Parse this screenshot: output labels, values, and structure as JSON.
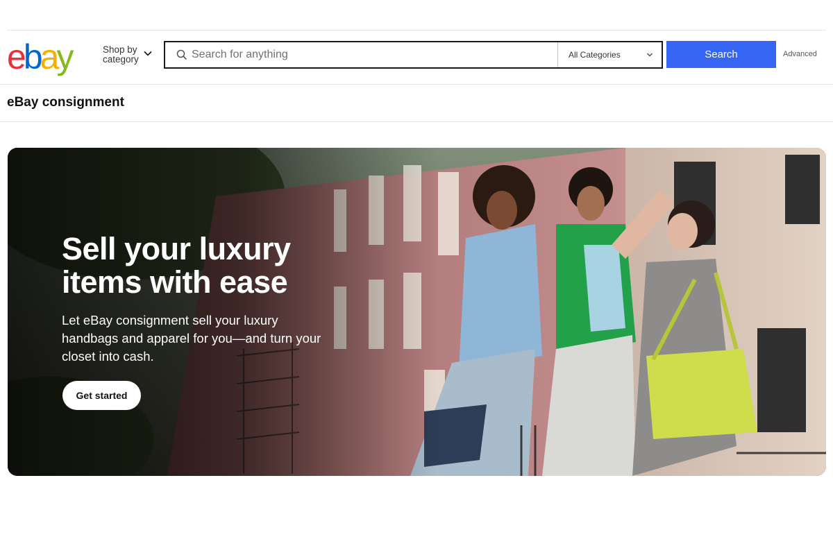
{
  "header": {
    "logo_letters": [
      "e",
      "b",
      "a",
      "y"
    ],
    "logo_colors": [
      "#e53238",
      "#0064d2",
      "#f5af02",
      "#86b817"
    ],
    "shop_by_line1": "Shop by",
    "shop_by_line2": "category",
    "search_placeholder": "Search for anything",
    "category_selected": "All Categories",
    "search_button": "Search",
    "advanced_link": "Advanced",
    "search_button_color": "#3665f3"
  },
  "page": {
    "title": "eBay consignment"
  },
  "hero": {
    "heading": "Sell your luxury items with ease",
    "body": "Let eBay consignment sell your luxury handbags and apparel for you—and turn your closet into cash.",
    "cta": "Get started"
  }
}
